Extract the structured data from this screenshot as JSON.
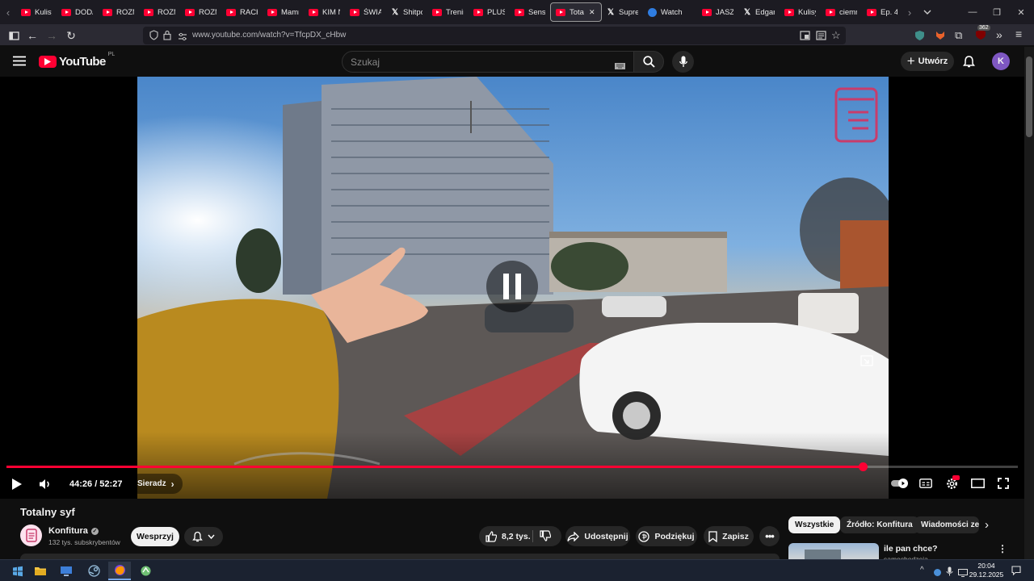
{
  "browser": {
    "tabs": [
      {
        "label": "Kulisy",
        "icon": "youtube-icon",
        "width": 50
      },
      {
        "label": "DODA",
        "icon": "youtube-icon",
        "width": 51
      },
      {
        "label": "ROZM",
        "icon": "youtube-icon",
        "width": 51
      },
      {
        "label": "ROZM",
        "icon": "youtube-icon",
        "width": 51
      },
      {
        "label": "ROZM",
        "icon": "youtube-icon",
        "width": 51
      },
      {
        "label": "RACH",
        "icon": "youtube-icon",
        "width": 51
      },
      {
        "label": "Mamr",
        "icon": "youtube-icon",
        "width": 51
      },
      {
        "label": "KIM N",
        "icon": "youtube-icon",
        "width": 51
      },
      {
        "label": "ŚWIĄ",
        "icon": "youtube-icon",
        "width": 51
      },
      {
        "label": "Shitpo",
        "icon": "x-icon",
        "width": 51
      },
      {
        "label": "Trenin",
        "icon": "youtube-icon",
        "width": 51
      },
      {
        "label": "PLUSK",
        "icon": "youtube-icon",
        "width": 51
      },
      {
        "label": "Sens p",
        "icon": "youtube-icon",
        "width": 50
      },
      {
        "label": "Tota",
        "icon": "youtube-icon",
        "width": 64,
        "active": true
      },
      {
        "label": "Supre",
        "icon": "x-icon",
        "width": 51
      },
      {
        "label": "Watch",
        "icon": "blue-circle-icon",
        "width": 67
      },
      {
        "label": "JASZC",
        "icon": "youtube-icon",
        "width": 51
      },
      {
        "label": "Edgar",
        "icon": "x-icon",
        "width": 51
      },
      {
        "label": "Kulisy",
        "icon": "youtube-icon",
        "width": 51
      },
      {
        "label": "ciemn",
        "icon": "youtube-icon",
        "width": 51
      },
      {
        "label": "Ep. 4",
        "icon": "youtube-icon",
        "width": 50
      }
    ],
    "url": "www.youtube.com/watch?v=TfcpDX_cHbw",
    "extension_badge": "362"
  },
  "youtube": {
    "logo_text": "YouTube",
    "region": "PL",
    "search_placeholder": "Szukaj",
    "create_label": "Utwórz",
    "avatar_letter": "K"
  },
  "player": {
    "time_current": "44:26",
    "time_total": "52:27",
    "time_text": "44:26 / 52:27",
    "progress": 0.847,
    "chapter": "Sieradz"
  },
  "video": {
    "title": "Totalny syf",
    "channel": "Konfitura",
    "subscribers": "132 tys. subskrybentów",
    "support_label": "Wesprzyj",
    "likes": "8,2 tys.",
    "share_label": "Udostępnij",
    "thanks_label": "Podziękuj",
    "save_label": "Zapisz"
  },
  "chips": [
    "Wszystkie",
    "Źródło: Konfitura",
    "Wiadomości ze ś"
  ],
  "suggestion": {
    "title": "ile pan chce?",
    "channel": "samochodzeia"
  },
  "taskbar": {
    "time": "20:04",
    "date": "29.12.2025"
  },
  "colors": {
    "accent": "#ff0033",
    "background": "#0f0f0f"
  }
}
